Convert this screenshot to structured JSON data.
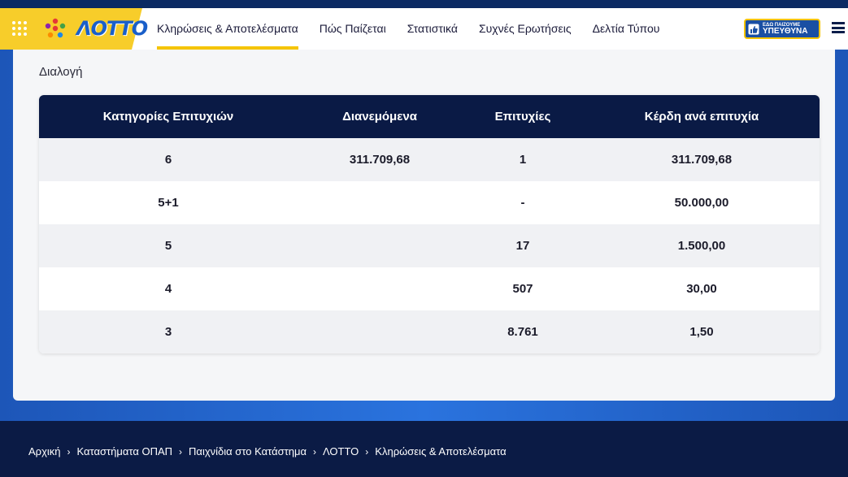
{
  "brand": {
    "name": "ΛΟΤΤΟ",
    "accent": "#f7cd2a",
    "primary": "#0a1a45"
  },
  "nav": {
    "items": [
      {
        "label": "Κληρώσεις & Αποτελέσματα",
        "active": true
      },
      {
        "label": "Πώς Παίζεται"
      },
      {
        "label": "Στατιστικά"
      },
      {
        "label": "Συχνές Ερωτήσεις"
      },
      {
        "label": "Δελτία Τύπου"
      }
    ]
  },
  "badge": {
    "line1": "ΕΔΩ ΠΑΙΖΟΥΜΕ",
    "line2": "ΥΠΕΥΘΥΝΑ"
  },
  "section": {
    "title": "Διαλογή"
  },
  "table": {
    "headers": [
      "Κατηγορίες Επιτυχιών",
      "Διανεμόμενα",
      "Επιτυχίες",
      "Κέρδη ανά επιτυχία"
    ],
    "rows": [
      [
        "6",
        "311.709,68",
        "1",
        "311.709,68"
      ],
      [
        "5+1",
        "",
        "-",
        "50.000,00"
      ],
      [
        "5",
        "",
        "17",
        "1.500,00"
      ],
      [
        "4",
        "",
        "507",
        "30,00"
      ],
      [
        "3",
        "",
        "8.761",
        "1,50"
      ]
    ]
  },
  "breadcrumb": [
    "Αρχική",
    "Καταστήματα ΟΠΑΠ",
    "Παιχνίδια στο Κατάστημα",
    "ΛΟΤΤΟ",
    "Κληρώσεις & Αποτελέσματα"
  ]
}
